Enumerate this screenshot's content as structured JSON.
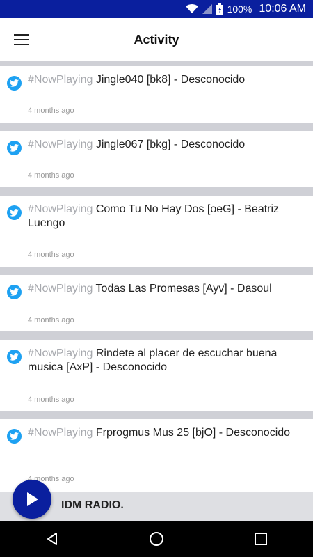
{
  "status_bar": {
    "battery": "100%",
    "time": "10:06 AM",
    "icons": [
      "wifi-icon",
      "signal-icon",
      "battery-charging-icon"
    ]
  },
  "app_bar": {
    "title": "Activity",
    "menu_icon": "hamburger-menu-icon"
  },
  "feed": {
    "items": [
      {
        "hashtag": "#NowPlaying",
        "text": " Jingle040 [bk8] - Desconocido",
        "time": "4 months ago"
      },
      {
        "hashtag": "#NowPlaying",
        "text": " Jingle067 [bkg] - Desconocido",
        "time": "4 months ago"
      },
      {
        "hashtag": "#NowPlaying",
        "text": " Como Tu No Hay Dos [oeG] - Beatriz Luengo",
        "time": "4 months ago"
      },
      {
        "hashtag": "#NowPlaying",
        "text": " Todas Las Promesas [Ayv] - Dasoul",
        "time": "4 months ago"
      },
      {
        "hashtag": "#NowPlaying",
        "text": " Rindete al placer de escuchar buena musica [AxP] - Desconocido",
        "time": "4 months ago"
      },
      {
        "hashtag": "#NowPlaying",
        "text": " Frprogmus Mus 25 [bjO] - Desconocido",
        "time": "4 months ago"
      }
    ]
  },
  "player": {
    "station_name": "IDM RADIO.",
    "play_icon": "play-icon"
  },
  "colors": {
    "primary": "#0a1f9e",
    "twitter": "#1da1f2",
    "hashtag": "#a7a9ae",
    "background": "#cfd0d6"
  }
}
